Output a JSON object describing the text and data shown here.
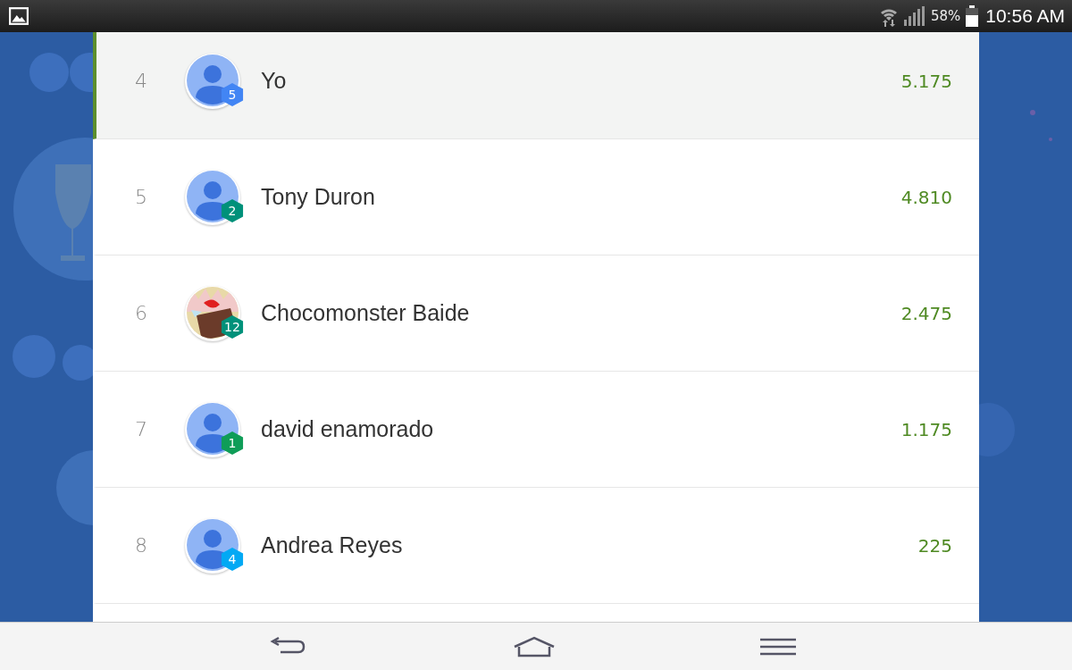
{
  "status_bar": {
    "battery": "58%",
    "time": "10:56 AM"
  },
  "leaderboard": [
    {
      "rank": "4",
      "name": "Yo",
      "score": "5.175",
      "level": "5",
      "color": "#4285f4",
      "avatar": {
        "kind": "default"
      },
      "selected": true
    },
    {
      "rank": "5",
      "name": "Tony Duron",
      "score": "4.810",
      "level": "2",
      "color": "#00917a",
      "avatar": {
        "kind": "default"
      },
      "selected": false
    },
    {
      "rank": "6",
      "name": "Chocomonster Baide",
      "score": "2.475",
      "level": "12",
      "color": "#00917a",
      "selected": false
    },
    {
      "rank": "7",
      "name": "david enamorado",
      "score": "1.175",
      "level": "1",
      "color": "#0f9d58",
      "avatar": {
        "kind": "default"
      },
      "selected": false
    },
    {
      "rank": "8",
      "name": "Andrea Reyes",
      "score": "225",
      "level": "4",
      "color": "#03a9f4",
      "avatar": {
        "kind": "default"
      },
      "selected": false
    }
  ]
}
